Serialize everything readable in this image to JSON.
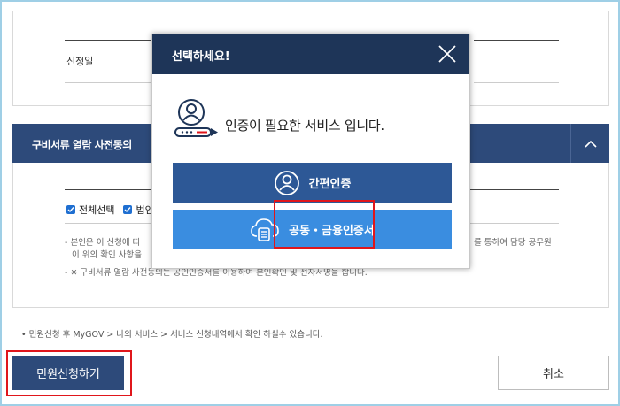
{
  "form": {
    "apply_date_label": "신청일"
  },
  "section": {
    "title": "구비서류 열람 사전동의",
    "select_all_label": "전체선택",
    "partial_label": "법인",
    "notes": [
      "- 본인은 이 신청에 따",
      "이 위의 확인 사항을",
      "- ※ 구비서류 열람 사전동의는 공인인증서를 이용하여 본인확인 및 전자서명을 합니다."
    ],
    "note_right_fragment": "를 통하여 담당 공무원"
  },
  "footer": {
    "notice": "• 민원신청 후 MyGOV > 나의 서비스 > 서비스 신청내역에서 확인 하실수 있습니다.",
    "apply_button": "민원신청하기",
    "cancel_button": "취소"
  },
  "modal": {
    "title": "선택하세요!",
    "message": "인증이 필요한 서비스 입니다.",
    "easy_auth_button": "간편인증",
    "cert_auth_button": "공동・금융인증서"
  },
  "colors": {
    "navy": "#2d4a7a",
    "modal_header": "#1e3558",
    "easy_btn": "#2d5896",
    "cert_btn": "#3a8de0",
    "highlight": "#e0161b"
  }
}
